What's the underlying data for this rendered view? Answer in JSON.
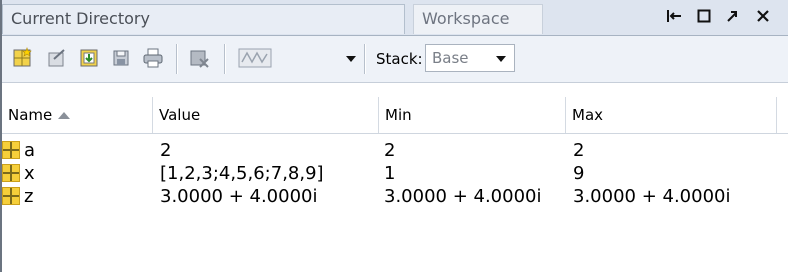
{
  "tabs": {
    "active_label": "Current Directory",
    "inactive_label": "Workspace"
  },
  "window_controls": [
    "dock",
    "maximize",
    "undock",
    "close"
  ],
  "toolbar": {
    "buttons": [
      "new-variable-icon",
      "open-selection-icon",
      "import-data-icon",
      "save-workspace-icon",
      "print-icon",
      "delete-icon",
      "plot-selection-icon"
    ],
    "stack_label": "Stack:",
    "stack_value": "Base"
  },
  "table": {
    "columns": [
      "Name",
      "Value",
      "Min",
      "Max"
    ],
    "sort_column": "Name",
    "rows": [
      {
        "name": "a",
        "value": "2",
        "min": "2",
        "max": "2"
      },
      {
        "name": "x",
        "value": "[1,2,3;4,5,6;7,8,9]",
        "min": "1",
        "max": "9"
      },
      {
        "name": "z",
        "value": "3.0000 + 4.0000i",
        "min": "3.0000 + 4.0000i",
        "max": "3.0000 + 4.0000i"
      }
    ]
  },
  "colors": {
    "variable_icon": "#f6cf3a",
    "tab_bar": "#dde4ef",
    "toolbar": "#eef2f8"
  }
}
